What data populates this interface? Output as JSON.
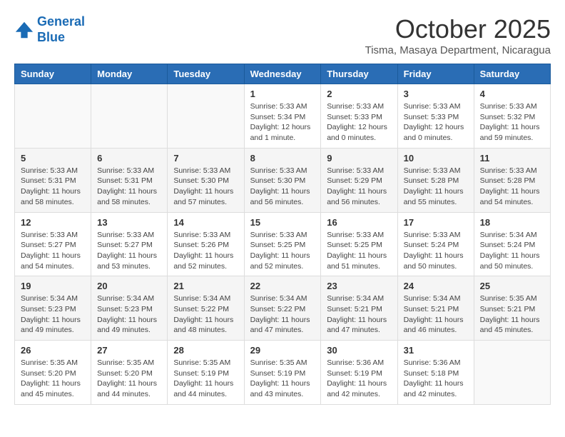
{
  "header": {
    "logo_line1": "General",
    "logo_line2": "Blue",
    "month_title": "October 2025",
    "location": "Tisma, Masaya Department, Nicaragua"
  },
  "weekdays": [
    "Sunday",
    "Monday",
    "Tuesday",
    "Wednesday",
    "Thursday",
    "Friday",
    "Saturday"
  ],
  "weeks": [
    [
      {
        "day": "",
        "info": ""
      },
      {
        "day": "",
        "info": ""
      },
      {
        "day": "",
        "info": ""
      },
      {
        "day": "1",
        "info": "Sunrise: 5:33 AM\nSunset: 5:34 PM\nDaylight: 12 hours\nand 1 minute."
      },
      {
        "day": "2",
        "info": "Sunrise: 5:33 AM\nSunset: 5:33 PM\nDaylight: 12 hours\nand 0 minutes."
      },
      {
        "day": "3",
        "info": "Sunrise: 5:33 AM\nSunset: 5:33 PM\nDaylight: 12 hours\nand 0 minutes."
      },
      {
        "day": "4",
        "info": "Sunrise: 5:33 AM\nSunset: 5:32 PM\nDaylight: 11 hours\nand 59 minutes."
      }
    ],
    [
      {
        "day": "5",
        "info": "Sunrise: 5:33 AM\nSunset: 5:31 PM\nDaylight: 11 hours\nand 58 minutes."
      },
      {
        "day": "6",
        "info": "Sunrise: 5:33 AM\nSunset: 5:31 PM\nDaylight: 11 hours\nand 58 minutes."
      },
      {
        "day": "7",
        "info": "Sunrise: 5:33 AM\nSunset: 5:30 PM\nDaylight: 11 hours\nand 57 minutes."
      },
      {
        "day": "8",
        "info": "Sunrise: 5:33 AM\nSunset: 5:30 PM\nDaylight: 11 hours\nand 56 minutes."
      },
      {
        "day": "9",
        "info": "Sunrise: 5:33 AM\nSunset: 5:29 PM\nDaylight: 11 hours\nand 56 minutes."
      },
      {
        "day": "10",
        "info": "Sunrise: 5:33 AM\nSunset: 5:28 PM\nDaylight: 11 hours\nand 55 minutes."
      },
      {
        "day": "11",
        "info": "Sunrise: 5:33 AM\nSunset: 5:28 PM\nDaylight: 11 hours\nand 54 minutes."
      }
    ],
    [
      {
        "day": "12",
        "info": "Sunrise: 5:33 AM\nSunset: 5:27 PM\nDaylight: 11 hours\nand 54 minutes."
      },
      {
        "day": "13",
        "info": "Sunrise: 5:33 AM\nSunset: 5:27 PM\nDaylight: 11 hours\nand 53 minutes."
      },
      {
        "day": "14",
        "info": "Sunrise: 5:33 AM\nSunset: 5:26 PM\nDaylight: 11 hours\nand 52 minutes."
      },
      {
        "day": "15",
        "info": "Sunrise: 5:33 AM\nSunset: 5:25 PM\nDaylight: 11 hours\nand 52 minutes."
      },
      {
        "day": "16",
        "info": "Sunrise: 5:33 AM\nSunset: 5:25 PM\nDaylight: 11 hours\nand 51 minutes."
      },
      {
        "day": "17",
        "info": "Sunrise: 5:33 AM\nSunset: 5:24 PM\nDaylight: 11 hours\nand 50 minutes."
      },
      {
        "day": "18",
        "info": "Sunrise: 5:34 AM\nSunset: 5:24 PM\nDaylight: 11 hours\nand 50 minutes."
      }
    ],
    [
      {
        "day": "19",
        "info": "Sunrise: 5:34 AM\nSunset: 5:23 PM\nDaylight: 11 hours\nand 49 minutes."
      },
      {
        "day": "20",
        "info": "Sunrise: 5:34 AM\nSunset: 5:23 PM\nDaylight: 11 hours\nand 49 minutes."
      },
      {
        "day": "21",
        "info": "Sunrise: 5:34 AM\nSunset: 5:22 PM\nDaylight: 11 hours\nand 48 minutes."
      },
      {
        "day": "22",
        "info": "Sunrise: 5:34 AM\nSunset: 5:22 PM\nDaylight: 11 hours\nand 47 minutes."
      },
      {
        "day": "23",
        "info": "Sunrise: 5:34 AM\nSunset: 5:21 PM\nDaylight: 11 hours\nand 47 minutes."
      },
      {
        "day": "24",
        "info": "Sunrise: 5:34 AM\nSunset: 5:21 PM\nDaylight: 11 hours\nand 46 minutes."
      },
      {
        "day": "25",
        "info": "Sunrise: 5:35 AM\nSunset: 5:21 PM\nDaylight: 11 hours\nand 45 minutes."
      }
    ],
    [
      {
        "day": "26",
        "info": "Sunrise: 5:35 AM\nSunset: 5:20 PM\nDaylight: 11 hours\nand 45 minutes."
      },
      {
        "day": "27",
        "info": "Sunrise: 5:35 AM\nSunset: 5:20 PM\nDaylight: 11 hours\nand 44 minutes."
      },
      {
        "day": "28",
        "info": "Sunrise: 5:35 AM\nSunset: 5:19 PM\nDaylight: 11 hours\nand 44 minutes."
      },
      {
        "day": "29",
        "info": "Sunrise: 5:35 AM\nSunset: 5:19 PM\nDaylight: 11 hours\nand 43 minutes."
      },
      {
        "day": "30",
        "info": "Sunrise: 5:36 AM\nSunset: 5:19 PM\nDaylight: 11 hours\nand 42 minutes."
      },
      {
        "day": "31",
        "info": "Sunrise: 5:36 AM\nSunset: 5:18 PM\nDaylight: 11 hours\nand 42 minutes."
      },
      {
        "day": "",
        "info": ""
      }
    ]
  ]
}
